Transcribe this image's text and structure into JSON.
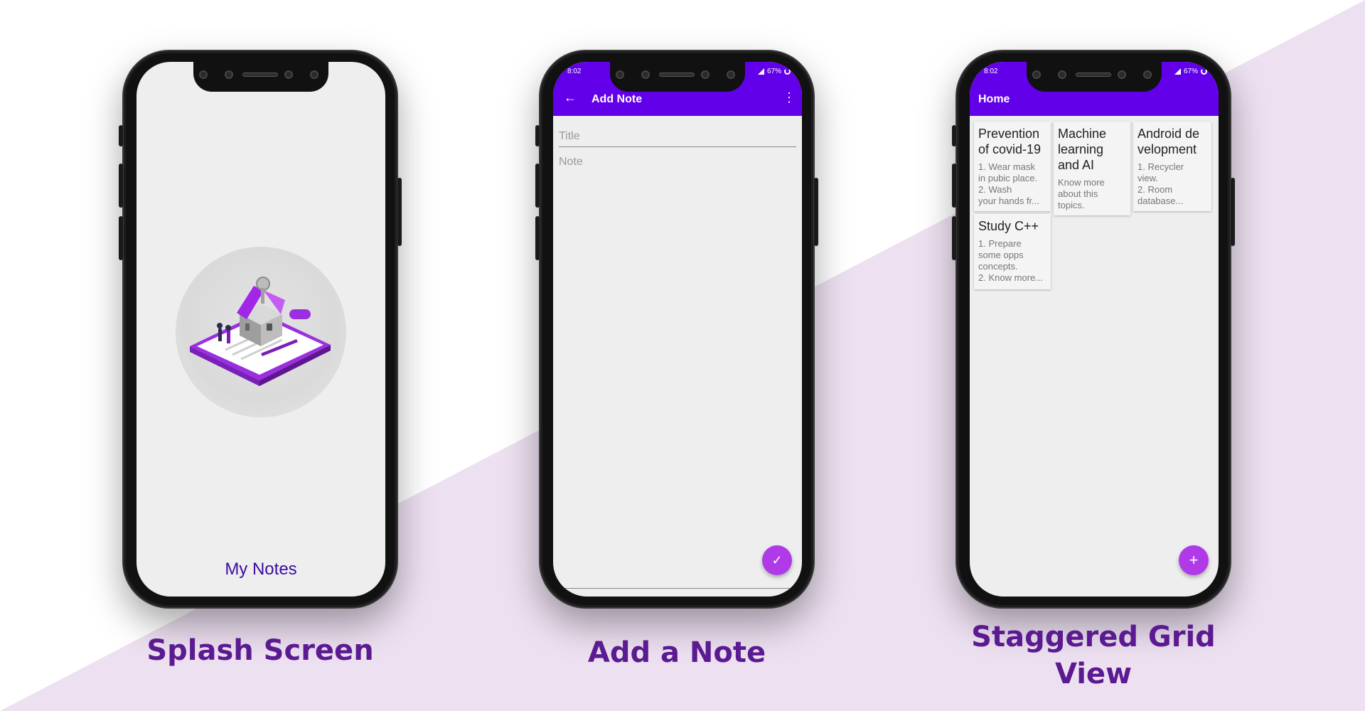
{
  "colors": {
    "accent": "#6200ea",
    "fab": "#b039e8",
    "caption": "#5b1a91",
    "splash_title": "#3a0ca3",
    "background_diagonal": "#ede0f1"
  },
  "splash": {
    "app_name": "My Notes",
    "caption": "Splash Screen",
    "illustration": "house-on-clipboard-illustration"
  },
  "add_note": {
    "status_time": "8:02",
    "status_battery": "67%",
    "appbar_title": "Add Note",
    "title_placeholder": "Title",
    "note_placeholder": "Note",
    "back_icon": "arrow-back-icon",
    "menu_icon": "more-vert-icon",
    "fab_icon": "check-icon",
    "caption": "Add a Note"
  },
  "grid": {
    "status_time": "8:02",
    "status_battery": "67%",
    "appbar_title": "Home",
    "fab_icon": "add-icon",
    "caption_line1": "Staggered Grid",
    "caption_line2": "View",
    "notes": [
      {
        "title": "Prevention\nof covid-19",
        "body": "1. Wear mask\nin pubic place.\n2. Wash\nyour hands fr..."
      },
      {
        "title": "Machine\nlearning\nand AI",
        "body": "Know more\nabout this\ntopics."
      },
      {
        "title": "Android de\nvelopment",
        "body": "1. Recycler\nview.\n2. Room\ndatabase..."
      },
      {
        "title": "Study C++",
        "body": "1. Prepare\nsome opps\nconcepts.\n2. Know more..."
      }
    ]
  }
}
